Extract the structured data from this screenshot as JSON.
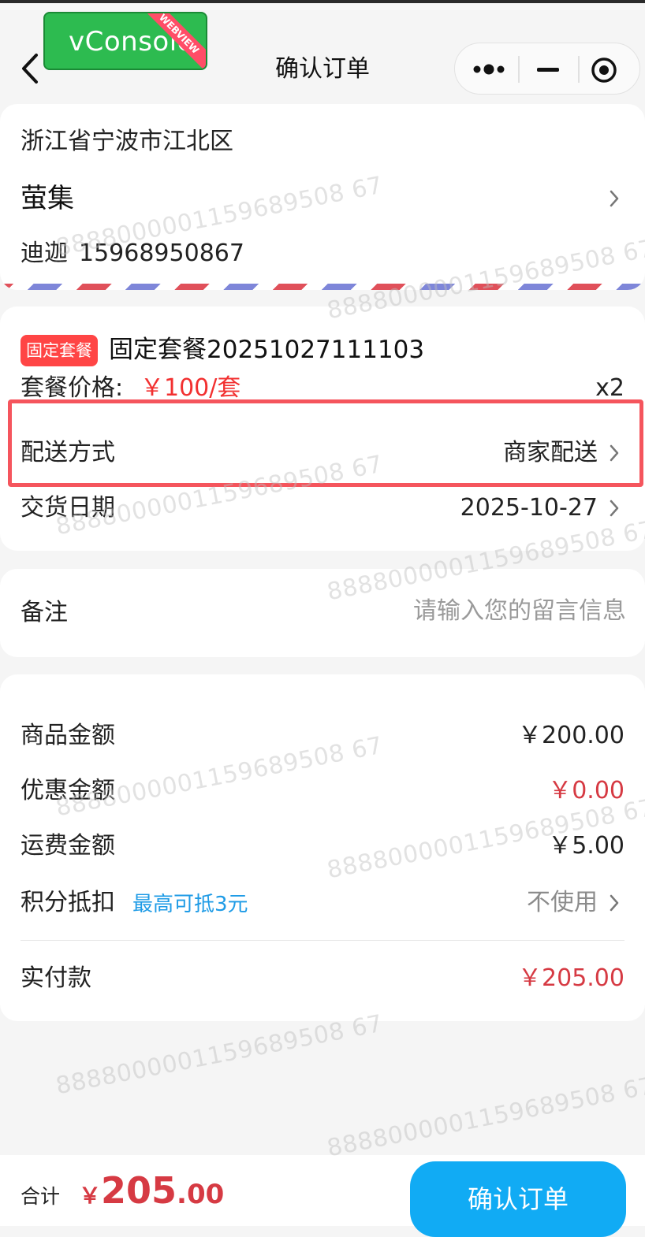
{
  "nav": {
    "title": "确认订单"
  },
  "debug": {
    "badge": "vConsole",
    "ribbon": "WEBVIEW"
  },
  "address": {
    "region": "浙江省宁波市江北区",
    "detail": "萤集",
    "name": "迪迦",
    "phone": "15968950867"
  },
  "order": {
    "tag": "固定套餐",
    "name": "固定套餐20251027111103",
    "price_label": "套餐价格:",
    "price": "￥100/套",
    "quantity": "x2",
    "delivery_label": "配送方式",
    "delivery_value": "商家配送",
    "date_label": "交货日期",
    "date_value": "2025-10-27"
  },
  "remark": {
    "label": "备注",
    "placeholder": "请输入您的留言信息"
  },
  "amounts": {
    "goods_label": "商品金额",
    "goods_value": "￥200.00",
    "discount_label": "优惠金额",
    "discount_value": "￥0.00",
    "shipping_label": "运费金额",
    "shipping_value": "￥5.00",
    "points_label": "积分抵扣",
    "points_hint": "最高可抵3元",
    "points_value": "不使用",
    "paid_label": "实付款",
    "paid_value": "￥205.00"
  },
  "footer": {
    "total_label": "合计",
    "currency": "￥",
    "total_int": "205",
    "total_dec": ".00",
    "submit": "确认订单"
  },
  "watermark": "8888000001159689508 67"
}
